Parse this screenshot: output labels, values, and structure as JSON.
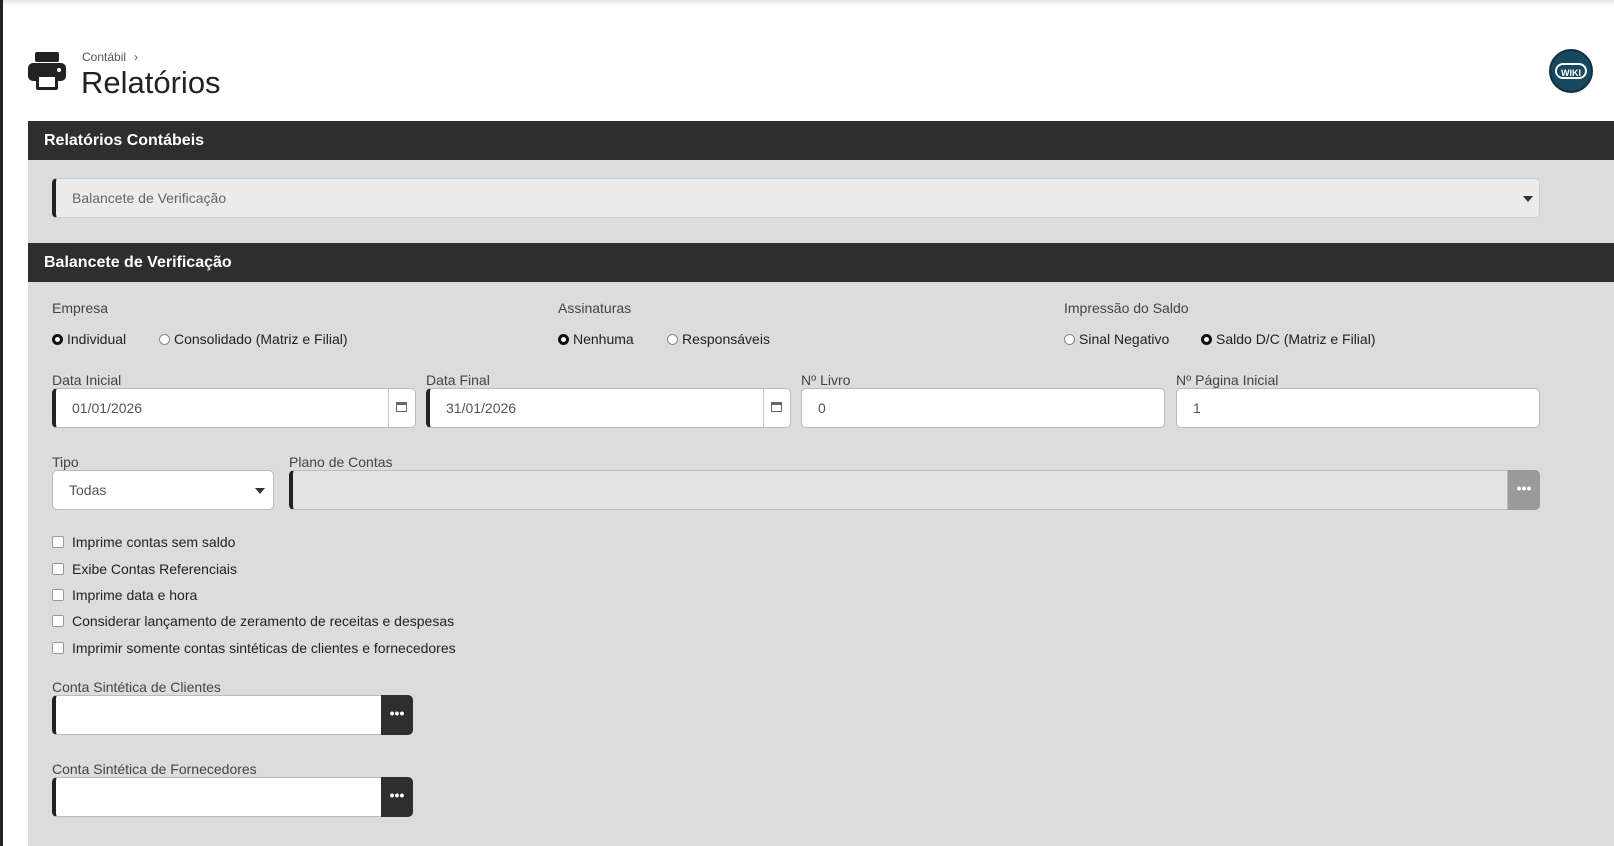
{
  "header": {
    "breadcrumb": "Contábil",
    "breadcrumb_sep": "›",
    "title": "Relatórios",
    "wiki_label": "WIKI"
  },
  "reports_section": {
    "title": "Relatórios Contábeis",
    "selected_report": "Balancete de Verificação"
  },
  "form_section": {
    "title": "Balancete de Verificação",
    "empresa": {
      "label": "Empresa",
      "options": [
        "Individual",
        "Consolidado (Matriz e Filial)"
      ],
      "selected": "Individual"
    },
    "assinaturas": {
      "label": "Assinaturas",
      "options": [
        "Nenhuma",
        "Responsáveis"
      ],
      "selected": "Nenhuma"
    },
    "impressao_saldo": {
      "label": "Impressão do Saldo",
      "options": [
        "Sinal Negativo",
        "Saldo D/C (Matriz e Filial)"
      ],
      "selected": "Saldo D/C (Matriz e Filial)"
    },
    "data_inicial": {
      "label": "Data Inicial",
      "value": "01/01/2026"
    },
    "data_final": {
      "label": "Data Final",
      "value": "31/01/2026"
    },
    "n_livro": {
      "label": "Nº Livro",
      "value": "0"
    },
    "n_pagina": {
      "label": "Nº Página Inicial",
      "value": "1"
    },
    "tipo": {
      "label": "Tipo",
      "value": "Todas"
    },
    "plano_contas": {
      "label": "Plano de Contas",
      "value": ""
    },
    "checkboxes": [
      "Imprime contas sem saldo",
      "Exibe Contas Referenciais",
      "Imprime data e hora",
      "Considerar lançamento de zeramento de receitas e despesas",
      "Imprimir somente contas sintéticas de clientes e fornecedores"
    ],
    "conta_clientes": {
      "label": "Conta Sintética de Clientes",
      "value": ""
    },
    "conta_fornecedores": {
      "label": "Conta Sintética de Fornecedores",
      "value": ""
    },
    "lookup_glyph": "•••"
  },
  "colors": {
    "section_bar": "#2e2e2e",
    "panel": "#dcdcdc",
    "wiki": "#17485e"
  }
}
